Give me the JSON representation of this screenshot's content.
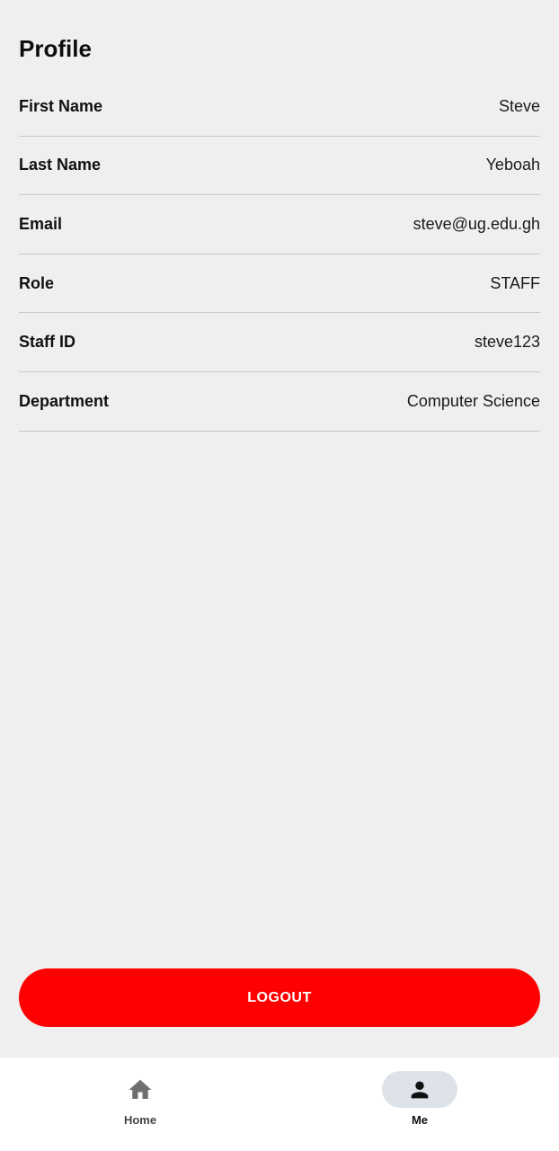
{
  "page": {
    "title": "Profile"
  },
  "profile": {
    "rows": [
      {
        "label": "First Name",
        "value": "Steve"
      },
      {
        "label": "Last Name",
        "value": "Yeboah"
      },
      {
        "label": "Email",
        "value": "steve@ug.edu.gh"
      },
      {
        "label": "Role",
        "value": "STAFF"
      },
      {
        "label": "Staff ID",
        "value": "steve123"
      },
      {
        "label": "Department",
        "value": "Computer Science"
      }
    ]
  },
  "actions": {
    "logout_label": "LOGOUT"
  },
  "bottom_nav": {
    "items": [
      {
        "label": "Home",
        "icon": "home-icon",
        "active": false
      },
      {
        "label": "Me",
        "icon": "person-icon",
        "active": true
      }
    ]
  },
  "colors": {
    "background": "#efefef",
    "logout": "#ff0000",
    "active_indicator": "#dde3e8"
  }
}
